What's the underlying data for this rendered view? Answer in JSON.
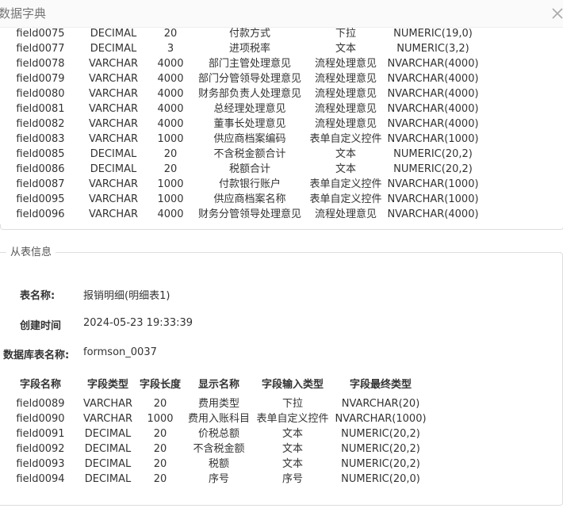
{
  "dialog": {
    "title": "数据字典"
  },
  "main_rows": [
    {
      "field": "field0075",
      "type": "DECIMAL",
      "length": "20",
      "display": "付款方式",
      "input": "下拉",
      "final": "NUMERIC(19,0)"
    },
    {
      "field": "field0077",
      "type": "DECIMAL",
      "length": "3",
      "display": "进项税率",
      "input": "文本",
      "final": "NUMERIC(3,2)"
    },
    {
      "field": "field0078",
      "type": "VARCHAR",
      "length": "4000",
      "display": "部门主管处理意见",
      "input": "流程处理意见",
      "final": "NVARCHAR(4000)"
    },
    {
      "field": "field0079",
      "type": "VARCHAR",
      "length": "4000",
      "display": "部门分管领导处理意见",
      "input": "流程处理意见",
      "final": "NVARCHAR(4000)"
    },
    {
      "field": "field0080",
      "type": "VARCHAR",
      "length": "4000",
      "display": "财务部负责人处理意见",
      "input": "流程处理意见",
      "final": "NVARCHAR(4000)"
    },
    {
      "field": "field0081",
      "type": "VARCHAR",
      "length": "4000",
      "display": "总经理处理意见",
      "input": "流程处理意见",
      "final": "NVARCHAR(4000)"
    },
    {
      "field": "field0082",
      "type": "VARCHAR",
      "length": "4000",
      "display": "董事长处理意见",
      "input": "流程处理意见",
      "final": "NVARCHAR(4000)"
    },
    {
      "field": "field0083",
      "type": "VARCHAR",
      "length": "1000",
      "display": "供应商档案编码",
      "input": "表单自定义控件",
      "final": "NVARCHAR(1000)"
    },
    {
      "field": "field0085",
      "type": "DECIMAL",
      "length": "20",
      "display": "不含税金额合计",
      "input": "文本",
      "final": "NUMERIC(20,2)"
    },
    {
      "field": "field0086",
      "type": "DECIMAL",
      "length": "20",
      "display": "税额合计",
      "input": "文本",
      "final": "NUMERIC(20,2)"
    },
    {
      "field": "field0087",
      "type": "VARCHAR",
      "length": "1000",
      "display": "付款银行账户",
      "input": "表单自定义控件",
      "final": "NVARCHAR(1000)"
    },
    {
      "field": "field0095",
      "type": "VARCHAR",
      "length": "1000",
      "display": "供应商档案名称",
      "input": "表单自定义控件",
      "final": "NVARCHAR(1000)"
    },
    {
      "field": "field0096",
      "type": "VARCHAR",
      "length": "4000",
      "display": "财务分管领导处理意见",
      "input": "流程处理意见",
      "final": "NVARCHAR(4000)"
    }
  ],
  "sub_table": {
    "legend": "从表信息",
    "table_name_label": "表名称:",
    "table_name_value": "报销明细(明细表1)",
    "created_label": "创建时间",
    "created_value": "2024-05-23 19:33:39",
    "db_name_label": "数据库表名称:",
    "db_name_value": "formson_0037",
    "headers": [
      "字段名称",
      "字段类型",
      "字段长度",
      "显示名称",
      "字段输入类型",
      "字段最终类型"
    ],
    "rows": [
      {
        "field": "field0089",
        "type": "VARCHAR",
        "length": "20",
        "display": "费用类型",
        "input": "下拉",
        "final": "NVARCHAR(20)"
      },
      {
        "field": "field0090",
        "type": "VARCHAR",
        "length": "1000",
        "display": "费用入账科目",
        "input": "表单自定义控件",
        "final": "NVARCHAR(1000)"
      },
      {
        "field": "field0091",
        "type": "DECIMAL",
        "length": "20",
        "display": "价税总额",
        "input": "文本",
        "final": "NUMERIC(20,2)"
      },
      {
        "field": "field0092",
        "type": "DECIMAL",
        "length": "20",
        "display": "不含税金额",
        "input": "文本",
        "final": "NUMERIC(20,2)"
      },
      {
        "field": "field0093",
        "type": "DECIMAL",
        "length": "20",
        "display": "税额",
        "input": "文本",
        "final": "NUMERIC(20,2)"
      },
      {
        "field": "field0094",
        "type": "DECIMAL",
        "length": "20",
        "display": "序号",
        "input": "序号",
        "final": "NUMERIC(20,0)"
      }
    ]
  }
}
